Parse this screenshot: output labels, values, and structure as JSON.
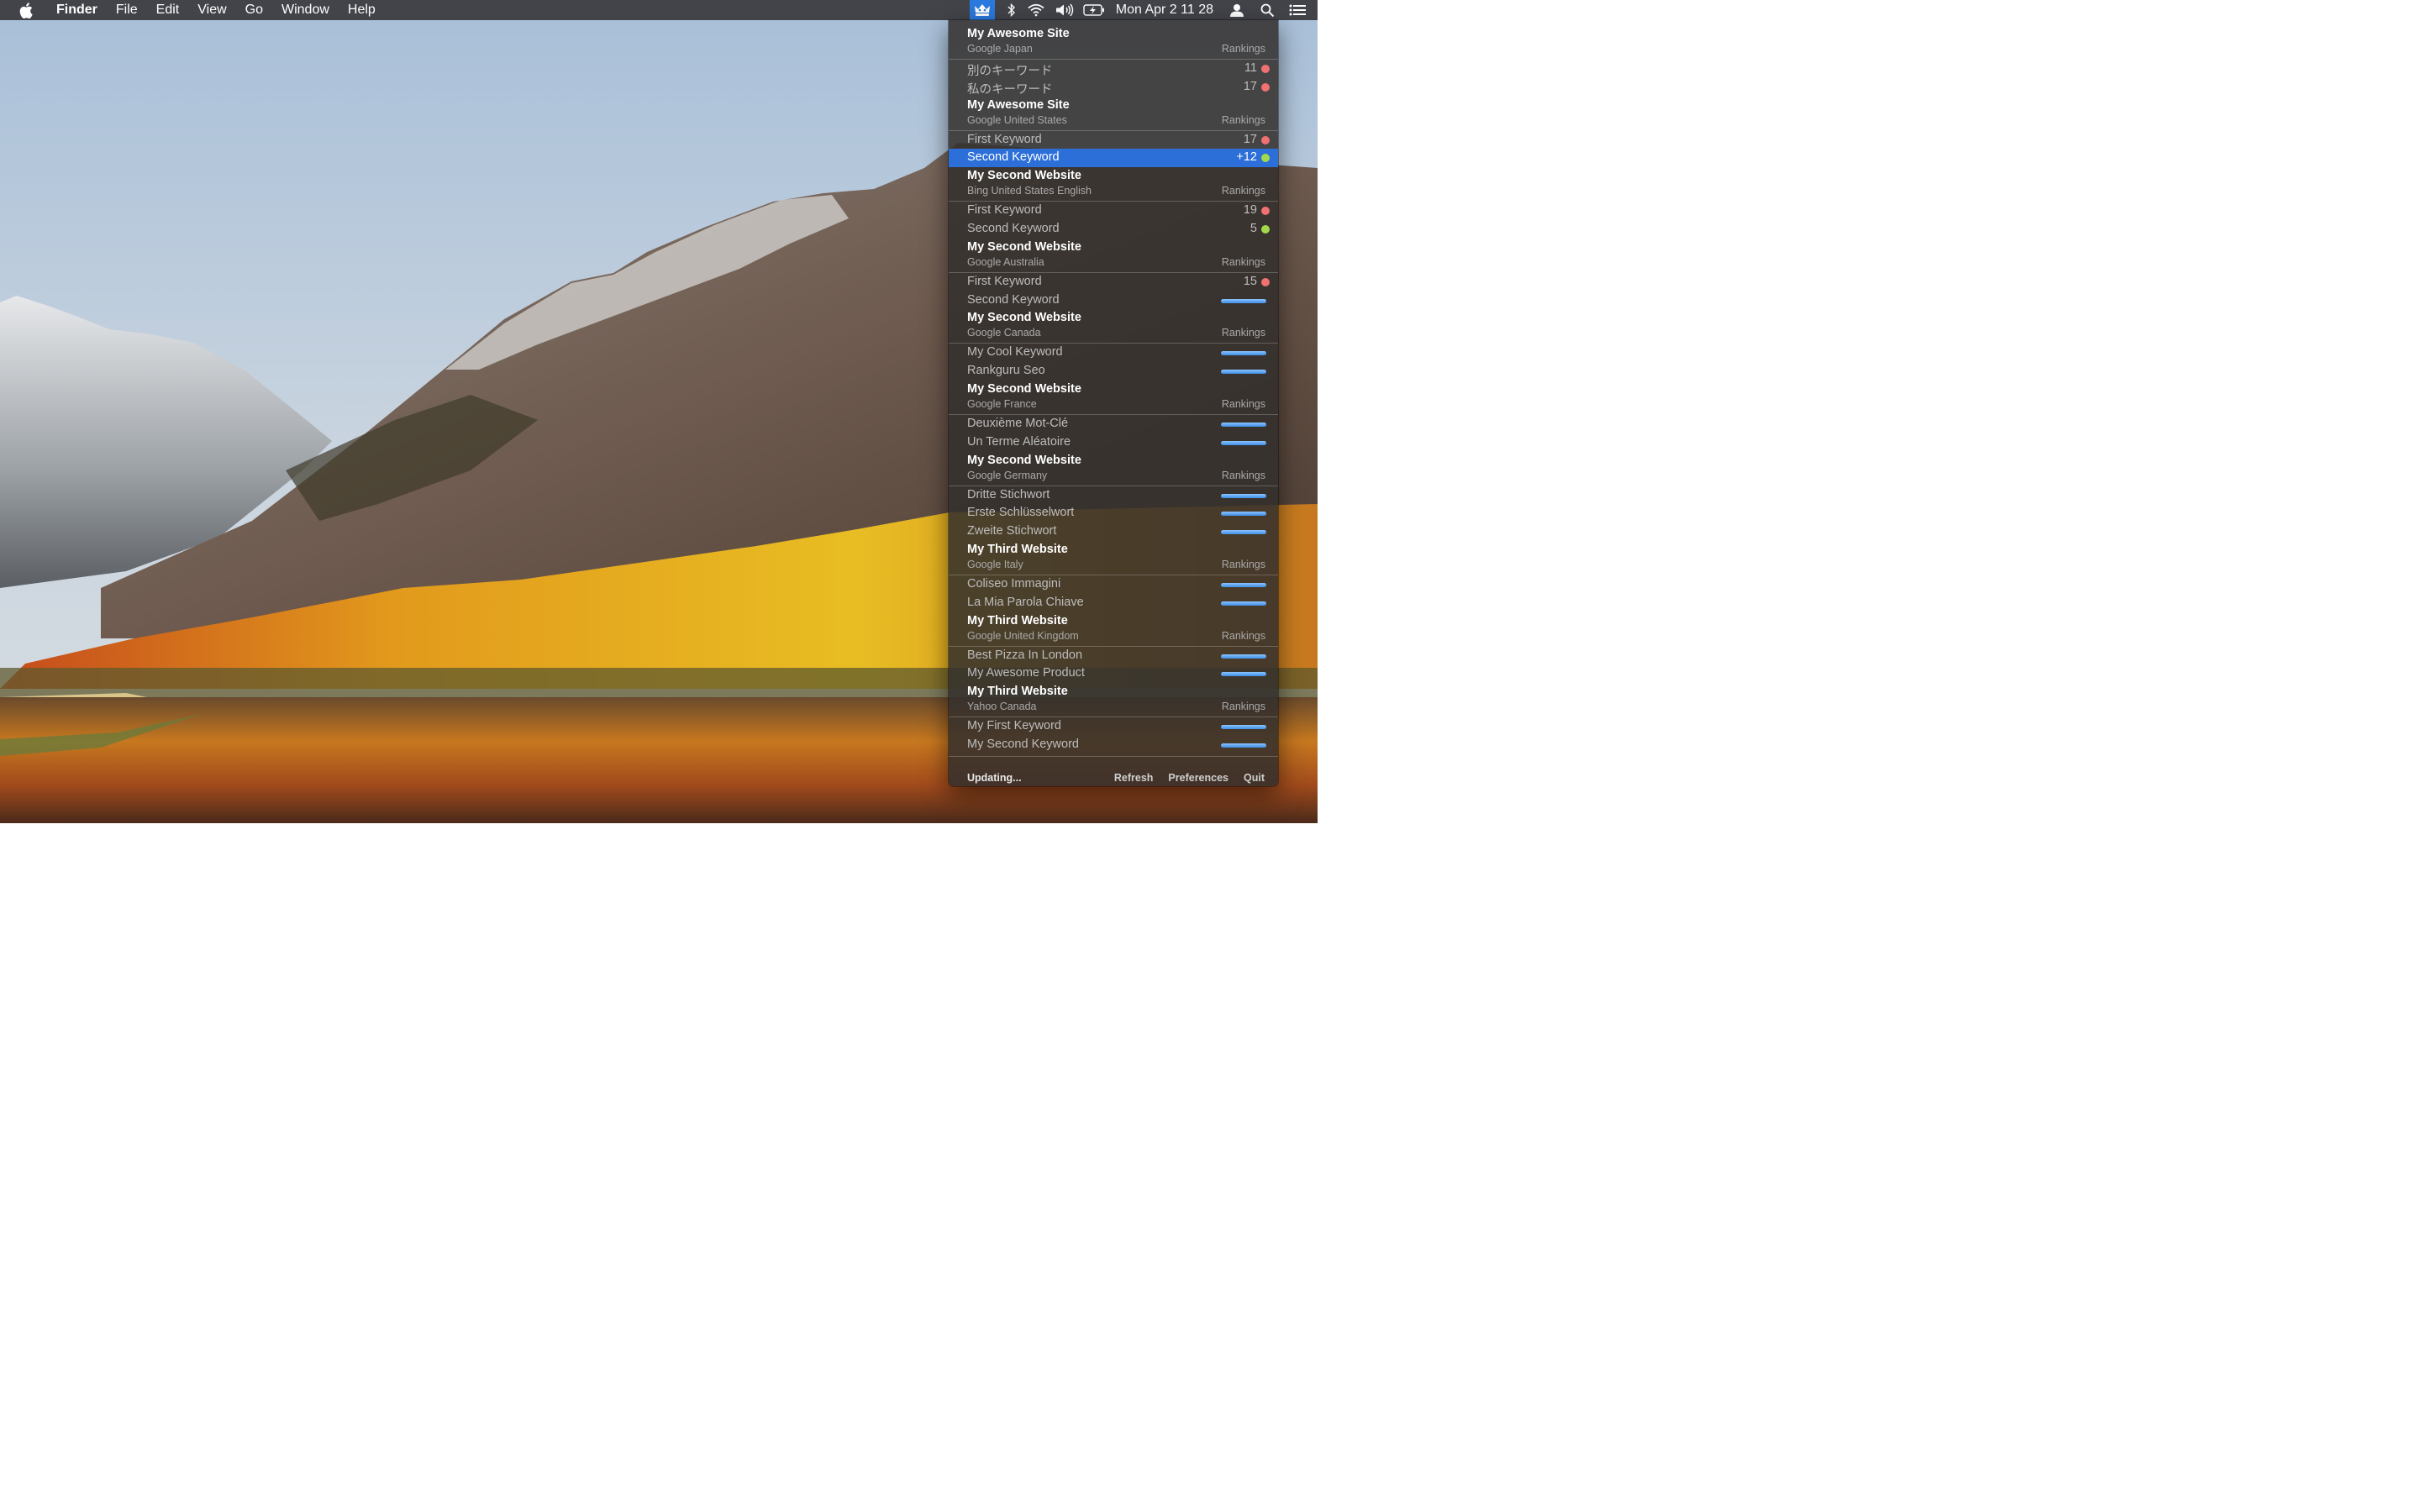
{
  "menubar": {
    "app_name": "Finder",
    "menus": [
      "File",
      "Edit",
      "View",
      "Go",
      "Window",
      "Help"
    ],
    "status_icons": [
      "rankguru-icon",
      "bluetooth-icon",
      "wifi-icon",
      "volume-icon",
      "battery-charging-icon"
    ],
    "clock": "Mon Apr 2  11 28",
    "right_icons": [
      "user-icon",
      "spotlight-search-icon",
      "notification-center-icon"
    ]
  },
  "dropdown": {
    "groups": [
      {
        "site": "My Awesome Site",
        "engine": "Google Japan",
        "rankings_label": "Rankings",
        "keywords": [
          {
            "name": "別のキーワード",
            "rank": "11",
            "status": "down"
          },
          {
            "name": "私のキーワード",
            "rank": "17",
            "status": "down"
          }
        ]
      },
      {
        "site": "My Awesome Site",
        "engine": "Google United States",
        "rankings_label": "Rankings",
        "keywords": [
          {
            "name": "First Keyword",
            "rank": "17",
            "status": "down"
          },
          {
            "name": "Second Keyword",
            "rank": "+12",
            "status": "up",
            "highlighted": true
          }
        ]
      },
      {
        "site": "My Second Website",
        "engine": "Bing United States English",
        "rankings_label": "Rankings",
        "keywords": [
          {
            "name": "First Keyword",
            "rank": "19",
            "status": "down"
          },
          {
            "name": "Second Keyword",
            "rank": "5",
            "status": "up"
          }
        ]
      },
      {
        "site": "My Second Website",
        "engine": "Google Australia",
        "rankings_label": "Rankings",
        "keywords": [
          {
            "name": "First Keyword",
            "rank": "15",
            "status": "down"
          },
          {
            "name": "Second Keyword",
            "rank": "",
            "status": "pending"
          }
        ]
      },
      {
        "site": "My Second Website",
        "engine": "Google Canada",
        "rankings_label": "Rankings",
        "keywords": [
          {
            "name": "My Cool Keyword",
            "rank": "",
            "status": "pending"
          },
          {
            "name": "Rankguru Seo",
            "rank": "",
            "status": "pending"
          }
        ]
      },
      {
        "site": "My Second Website",
        "engine": "Google France",
        "rankings_label": "Rankings",
        "keywords": [
          {
            "name": "Deuxième Mot-Clé",
            "rank": "",
            "status": "pending"
          },
          {
            "name": "Un Terme Aléatoire",
            "rank": "",
            "status": "pending"
          }
        ]
      },
      {
        "site": "My Second Website",
        "engine": "Google Germany",
        "rankings_label": "Rankings",
        "keywords": [
          {
            "name": "Dritte Stichwort",
            "rank": "",
            "status": "pending"
          },
          {
            "name": "Erste Schlüsselwort",
            "rank": "",
            "status": "pending"
          },
          {
            "name": "Zweite Stichwort",
            "rank": "",
            "status": "pending"
          }
        ]
      },
      {
        "site": "My Third Website",
        "engine": "Google Italy",
        "rankings_label": "Rankings",
        "keywords": [
          {
            "name": "Coliseo Immagini",
            "rank": "",
            "status": "pending"
          },
          {
            "name": "La Mia Parola Chiave",
            "rank": "",
            "status": "pending"
          }
        ]
      },
      {
        "site": "My Third Website",
        "engine": "Google United Kingdom",
        "rankings_label": "Rankings",
        "keywords": [
          {
            "name": "Best Pizza In London",
            "rank": "",
            "status": "pending"
          },
          {
            "name": "My Awesome Product",
            "rank": "",
            "status": "pending"
          }
        ]
      },
      {
        "site": "My Third Website",
        "engine": "Yahoo Canada",
        "rankings_label": "Rankings",
        "keywords": [
          {
            "name": "My First Keyword",
            "rank": "",
            "status": "pending"
          },
          {
            "name": "My Second Keyword",
            "rank": "",
            "status": "pending"
          }
        ]
      }
    ],
    "footer": {
      "status": "Updating...",
      "actions": [
        "Refresh",
        "Preferences",
        "Quit"
      ]
    }
  },
  "colors": {
    "highlight": "#2c6fd9",
    "rank_down": "#f07171",
    "rank_up": "#a3d94a",
    "pending_bar": "#4f9cf0"
  }
}
